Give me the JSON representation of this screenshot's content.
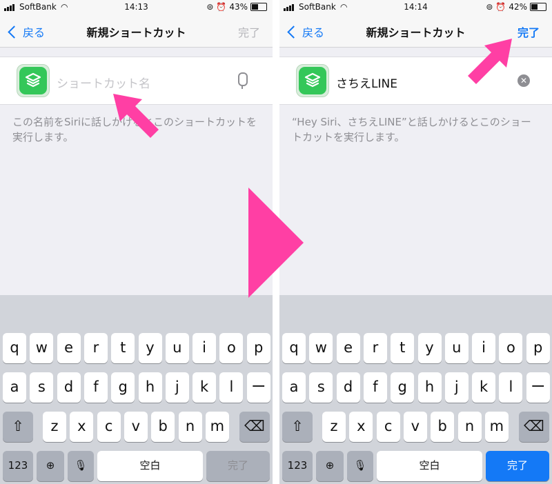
{
  "accent": "#1479f6",
  "arrow_color": "#ff3fa4",
  "left": {
    "status": {
      "carrier": "SoftBank",
      "time": "14:13",
      "battery": "43%"
    },
    "nav": {
      "back": "戻る",
      "title": "新規ショートカット",
      "done": "完了"
    },
    "field": {
      "placeholder": "ショートカット名",
      "value": ""
    },
    "help": "この名前をSiriに話しかけるとこのショートカットを実行します。",
    "keyboard": {
      "done_label": "完了"
    }
  },
  "right": {
    "status": {
      "carrier": "SoftBank",
      "time": "14:14",
      "battery": "42%"
    },
    "nav": {
      "back": "戻る",
      "title": "新規ショートカット",
      "done": "完了"
    },
    "field": {
      "value": "さちえLINE"
    },
    "help": "“Hey Siri、さちえLINE”と話しかけるとこのショートカットを実行します。",
    "keyboard": {
      "done_label": "完了"
    }
  },
  "keyboard": {
    "row1": [
      "q",
      "w",
      "e",
      "r",
      "t",
      "y",
      "u",
      "i",
      "o",
      "p"
    ],
    "row2": [
      "a",
      "s",
      "d",
      "f",
      "g",
      "h",
      "j",
      "k",
      "l",
      "ー"
    ],
    "row3": [
      "z",
      "x",
      "c",
      "v",
      "b",
      "n",
      "m"
    ],
    "num_label": "123",
    "space_label": "空白"
  }
}
